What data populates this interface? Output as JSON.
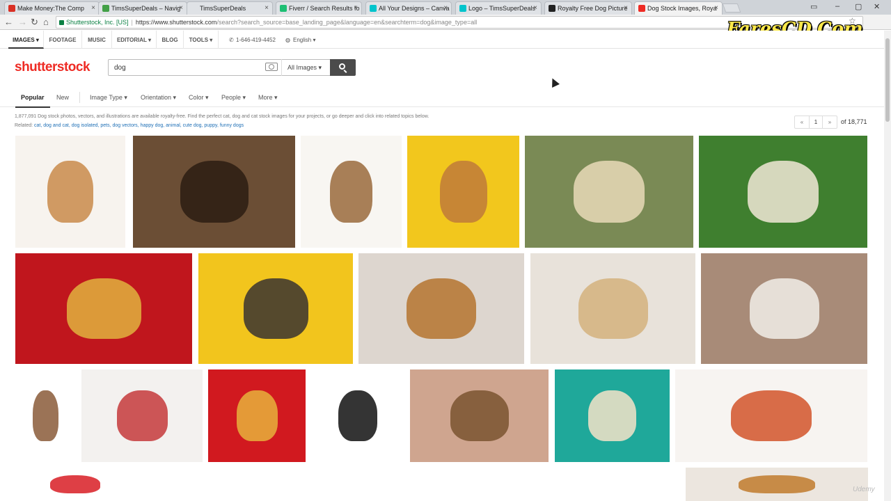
{
  "browser": {
    "tabs": [
      {
        "title": "Make Money:The Comp",
        "active": false,
        "icon_color": "#d93025"
      },
      {
        "title": "TimsSuperDeals – Navig",
        "active": false,
        "icon_color": "#43a047"
      },
      {
        "title": "TimsSuperDeals",
        "active": false,
        "icon_color": ""
      },
      {
        "title": "Fiverr / Search Results fo",
        "active": false,
        "icon_color": "#1dbf73"
      },
      {
        "title": "All Your Designs – Canva",
        "active": false,
        "icon_color": "#00c4cc"
      },
      {
        "title": "Logo – TimsSuperDeals",
        "active": false,
        "icon_color": "#00c4cc"
      },
      {
        "title": "Royalty Free Dog Picture",
        "active": false,
        "icon_color": "#222222"
      },
      {
        "title": "Dog Stock Images, Roya",
        "active": true,
        "icon_color": "#ee2b24"
      }
    ],
    "secure_label": "Shutterstock, Inc. [US]",
    "url_host": "https://www.shutterstock.com",
    "url_path": "/search?search_source=base_landing_page&language=en&searchterm=dog&image_type=all",
    "watermark": "FaresCD.Com"
  },
  "site_nav": {
    "items": [
      "IMAGES ▾",
      "FOOTAGE",
      "MUSIC",
      "EDITORIAL ▾",
      "BLOG",
      "TOOLS ▾"
    ],
    "phone": "1-646-419-4452",
    "language": "English ▾"
  },
  "search": {
    "logo": "shutterstock",
    "query": "dog",
    "image_type": "All Images ▾"
  },
  "filters": {
    "popular": "Popular",
    "new": "New",
    "image_type": "Image Type ▾",
    "orientation": "Orientation ▾",
    "color": "Color ▾",
    "people": "People ▾",
    "more": "More ▾"
  },
  "results": {
    "summary": "1,877,091 Dog stock photos, vectors, and illustrations are available royalty-free. Find the perfect cat, dog and cat stock images for your projects, or go deeper and click into related topics below.",
    "related_label": "Related:",
    "related_links": "cat, dog and cat, dog isolated, pets, dog vectors, happy dog, animal, cute dog, puppy, funny dogs"
  },
  "pagination": {
    "prev": "«",
    "page": "1",
    "next": "»",
    "of_label": "of 18,771"
  },
  "image_tiles": [
    {
      "desc": "cartoon-dogs-collection",
      "bg": "#f7f3ee",
      "accent": "#c98a4a"
    },
    {
      "desc": "puppy-lying-on-ground",
      "bg": "#6b4e35",
      "accent": "#2b1d12"
    },
    {
      "desc": "cartoon-dog-breeds",
      "bg": "#f8f6f2",
      "accent": "#9a6a3c"
    },
    {
      "desc": "dog-on-yellow",
      "bg": "#f2c71d",
      "accent": "#c07a3a"
    },
    {
      "desc": "man-petting-labrador",
      "bg": "#7a8a55",
      "accent": "#e9d9b8"
    },
    {
      "desc": "dog-on-grass",
      "bg": "#3f7f2f",
      "accent": "#f1e7d6"
    },
    {
      "desc": "chinese-new-year-2018",
      "bg": "#c0161d",
      "accent": "#e0b23e"
    },
    {
      "desc": "dog-yellow-background",
      "bg": "#f2c51d",
      "accent": "#3a3330"
    },
    {
      "desc": "golden-retriever-and-cat",
      "bg": "#ddd6cf",
      "accent": "#b5742f"
    },
    {
      "desc": "man-high-five-dog",
      "bg": "#e8e2da",
      "accent": "#d4b27c"
    },
    {
      "desc": "woman-with-white-dog",
      "bg": "#a88b78",
      "accent": "#f1ede7"
    },
    {
      "desc": "sitting-collie",
      "bg": "#ffffff",
      "accent": "#8a5a38"
    },
    {
      "desc": "happy-new-year-2018-dog",
      "bg": "#f3f1ef",
      "accent": "#c4393b"
    },
    {
      "desc": "red-chinese-dog-emblem",
      "bg": "#d1191f",
      "accent": "#e7b23c"
    },
    {
      "desc": "calligraphy-2018",
      "bg": "#ffffff",
      "accent": "#111111"
    },
    {
      "desc": "woman-with-pug",
      "bg": "#cfa58f",
      "accent": "#7a5330"
    },
    {
      "desc": "dog-icons-pattern",
      "bg": "#1fa89a",
      "accent": "#f4e3c8"
    },
    {
      "desc": "red-fox-dogs-set",
      "bg": "#f7f4f1",
      "accent": "#d2542a"
    },
    {
      "desc": "red-paper-dog",
      "bg": "#ffffff",
      "accent": "#d81d24"
    },
    {
      "desc": "blank-tile",
      "bg": "#ffffff",
      "accent": "#ffffff"
    },
    {
      "desc": "golden-dog-partial",
      "bg": "#ece6df",
      "accent": "#c17a2d"
    }
  ],
  "udemy_mark": "Udemy"
}
